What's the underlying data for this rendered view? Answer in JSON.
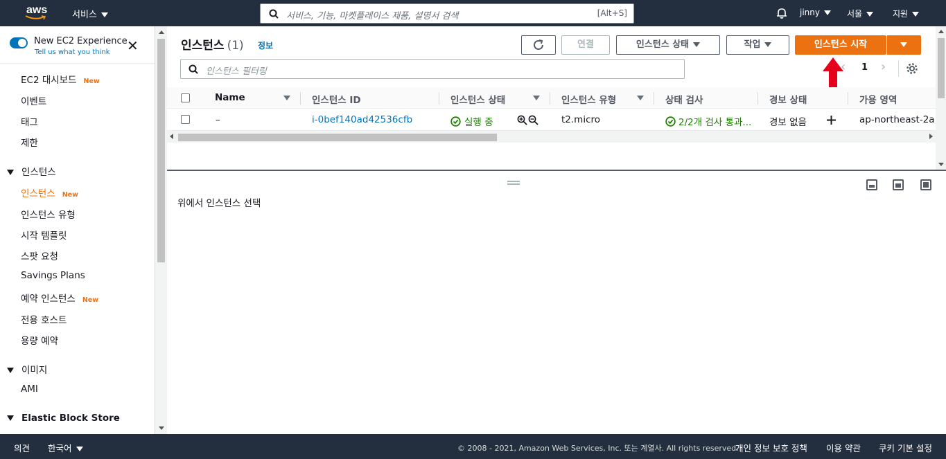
{
  "topnav": {
    "logo_text": "aws",
    "services_label": "서비스",
    "search_placeholder": "서비스, 기능, 마켓플레이스 제품, 설명서 검색",
    "search_shortcut": "[Alt+S]",
    "user": "jinny",
    "region": "서울",
    "support": "지원"
  },
  "sidebar": {
    "experience_title": "New EC2 Experience",
    "experience_sub": "Tell us what you think",
    "new_badge": "New",
    "items": [
      {
        "label": "EC2 대시보드",
        "new": true
      },
      {
        "label": "이벤트"
      },
      {
        "label": "태그"
      },
      {
        "label": "제한"
      }
    ],
    "sections": [
      {
        "label": "인스턴스",
        "items": [
          {
            "label": "인스턴스",
            "new": true,
            "active": true
          },
          {
            "label": "인스턴스 유형"
          },
          {
            "label": "시작 템플릿"
          },
          {
            "label": "스팟 요청"
          },
          {
            "label": "Savings Plans"
          },
          {
            "label": "예약 인스턴스",
            "new": true
          },
          {
            "label": "전용 호스트"
          },
          {
            "label": "용량 예약"
          }
        ]
      },
      {
        "label": "이미지",
        "items": [
          {
            "label": "AMI"
          }
        ]
      },
      {
        "label": "Elastic Block Store",
        "items": []
      }
    ]
  },
  "main": {
    "title": "인스턴스",
    "count": "(1)",
    "info": "정보",
    "buttons": {
      "connect": "연결",
      "instance_state": "인스턴스 상태",
      "actions": "작업",
      "launch": "인스턴스 시작"
    },
    "filter_placeholder": "인스턴스 필터링",
    "page": "1",
    "columns": [
      "Name",
      "인스턴스 ID",
      "인스턴스 상태",
      "인스턴스 유형",
      "상태 검사",
      "경보 상태",
      "가용 영역"
    ],
    "rows": [
      {
        "name": "–",
        "id": "i-0bef140ad42536cfb",
        "state": "실행 중",
        "type": "t2.micro",
        "check": "2/2개 검사 통과...",
        "alarm": "경보 없음",
        "az": "ap-northeast-2a"
      }
    ],
    "detail_text": "위에서 인스턴스 선택"
  },
  "footer": {
    "feedback": "의견",
    "language": "한국어",
    "copyright": "© 2008 - 2021, Amazon Web Services, Inc. 또는 계열사. All rights reserved.",
    "privacy": "개인 정보 보호 정책",
    "terms": "이용 약관",
    "cookies": "쿠키 기본 설정"
  },
  "colors": {
    "nav_bg": "#232f3e",
    "primary": "#ec7211",
    "link": "#0073bb",
    "success": "#1d8102",
    "annotation_arrow": "#e5001c"
  },
  "icons": [
    "search-icon",
    "bell-icon",
    "close-icon",
    "refresh-icon",
    "gear-icon",
    "zoom-in-icon",
    "zoom-out-icon",
    "check-circle-icon",
    "plus-icon",
    "red-arrow-annotation"
  ]
}
